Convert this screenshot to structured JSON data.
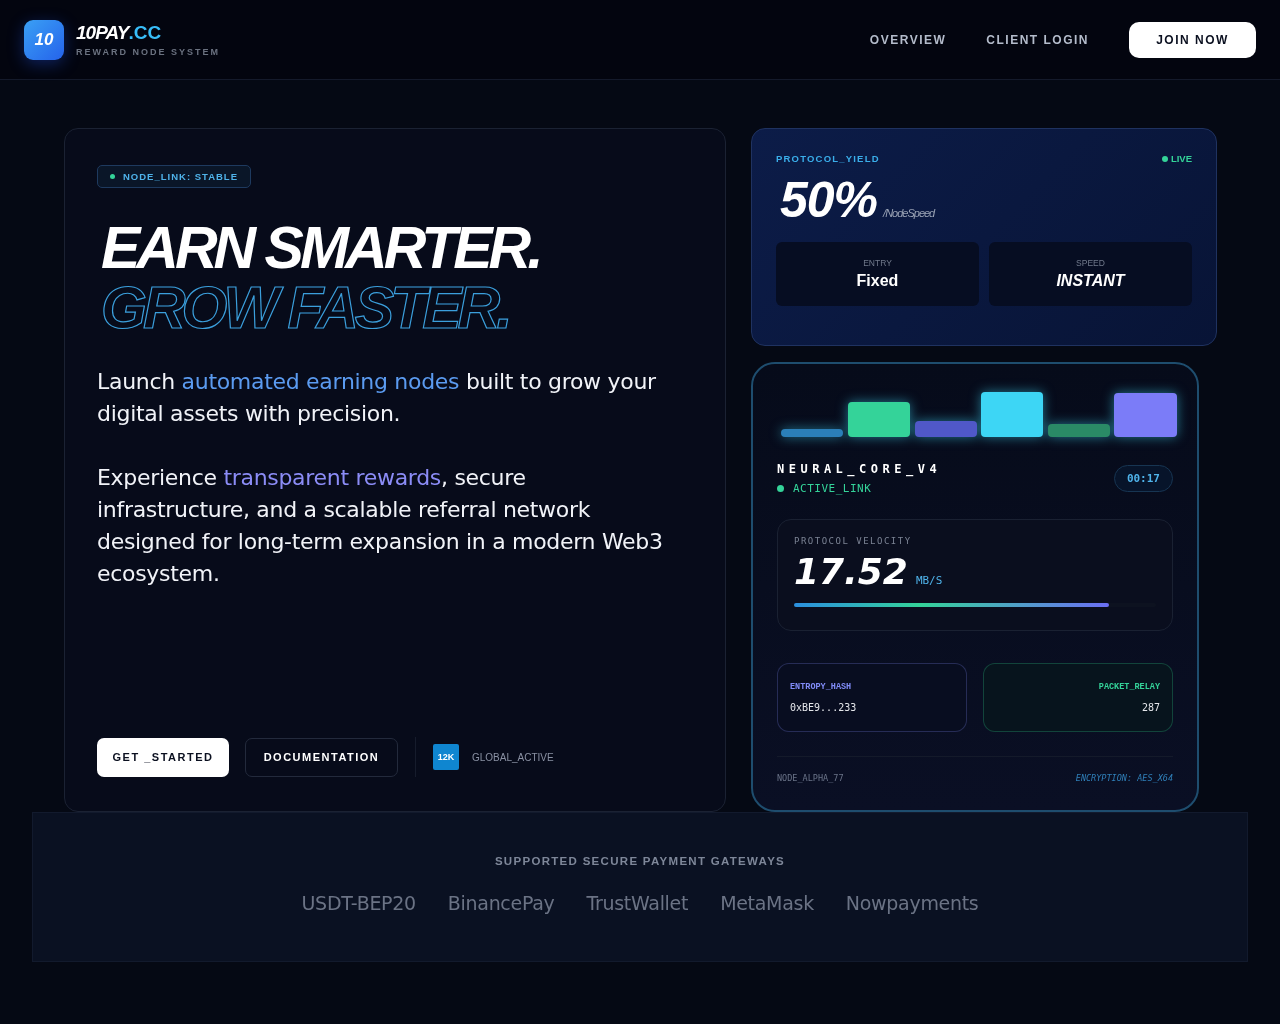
{
  "header": {
    "logo_badge": "10",
    "brand": "10PAY",
    "brand_suffix": ".CC",
    "tagline": "REWARD NODE SYSTEM",
    "nav": [
      {
        "label": "OVERVIEW"
      },
      {
        "label": "CLIENT LOGIN"
      }
    ],
    "cta": "JOIN NOW"
  },
  "hero": {
    "status_pill": "NODE_LINK: STABLE",
    "headline": "EARN SMARTER.",
    "headline_outline": "GROW FASTER.",
    "paragraphs": [
      "Launch **automated earning nodes** built to grow your digital assets with precision.",
      "Experience **transparent rewards**, secure infrastructure, and a scalable referral network designed for long-term expansion in a modern Web3 ecosystem."
    ],
    "buttons": [
      {
        "label": "GET _STARTED",
        "kind": "primary"
      },
      {
        "label": "DOCUMENTATION",
        "kind": "secondary"
      }
    ],
    "stat_badge": "12K",
    "stat_label": "GLOBAL_ACTIVE"
  },
  "yield_card": {
    "label": "PROTOCOL_YIELD",
    "live": "LIVE",
    "value": "50%",
    "unit": "/NodeSpeed",
    "tiles": [
      {
        "label": "ENTRY",
        "value": "Fixed",
        "italic": false
      },
      {
        "label": "SPEED",
        "value": "INSTANT",
        "italic": true
      }
    ]
  },
  "node_card": {
    "name": "NEURAL_CORE_V4",
    "status": "ACTIVE_LINK",
    "timer": "00:17",
    "velocity": {
      "label": "PROTOCOL VELOCITY",
      "value": "17.52",
      "unit": "MB/S",
      "level": 0.87
    },
    "stats": [
      {
        "label": "ENTROPY_HASH",
        "value": "0xBE9...233",
        "color": "#818cf8"
      },
      {
        "label": "PACKET_RELAY",
        "value": "287",
        "color": "#34d399"
      }
    ],
    "footer_left": "NODE_ALPHA_77",
    "footer_right": "ENCRYPTION: AES_X64"
  },
  "gateways": {
    "title": "SUPPORTED SECURE PAYMENT GATEWAYS",
    "items": [
      "USDT-BEP20",
      "BinancePay",
      "TrustWallet",
      "MetaMask",
      "Nowpayments"
    ]
  }
}
